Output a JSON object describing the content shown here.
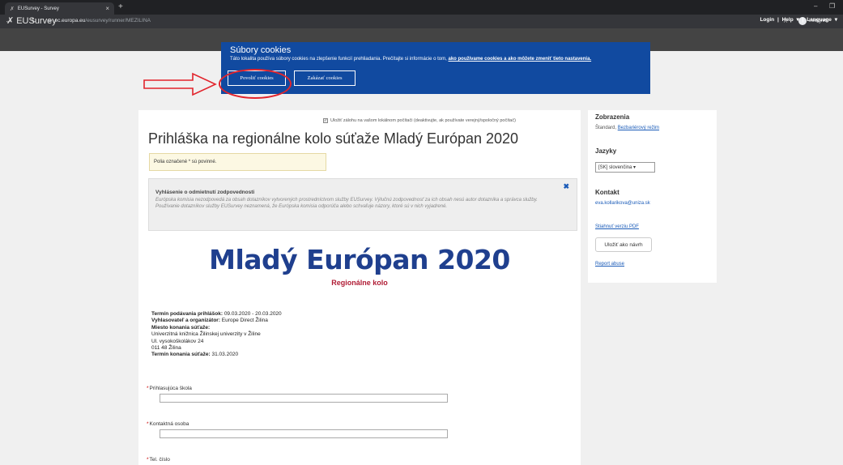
{
  "browser": {
    "tab_title": "EUSurvey - Survey",
    "url_host": "ec.europa.eu",
    "url_path": "/eusurvey/runner/MEZILINA",
    "incognito_label": "Inkognito"
  },
  "site": {
    "logo": "EUSurvey",
    "menu": [
      "Login",
      "|",
      "Help",
      "|",
      "Language"
    ]
  },
  "cookie": {
    "title": "Súbory cookies",
    "text": "Táto lokalita používa súbory cookies na zlepšenie funkcií prehliadania. Prečítajte si informácie o tom, ",
    "link": "ako používame cookies a ako môžete zmeniť tieto nastavenia.",
    "accept": "Povoliť cookies",
    "reject": "Zakázať cookies"
  },
  "form": {
    "backup_label": "Uložiť zálohu na vašom lokálnom počítači (deaktivujte, ak používate verejný/spoločný počítač)",
    "title": "Prihláška na regionálne kolo súťaže Mladý Európan 2020",
    "required_note": "Polia označené * sú povinné.",
    "disclaimer_title": "Vyhlásenie o odmietnutí zodpovednosti",
    "disclaimer_text": "Európska komisia nezodpovedá za obsah dotazníkov vytvorených prostredníctvom služby EUSurvey. Výlučnú zodpovednosť za ich obsah nesú autor dotazníka a správca služby. Používanie dotazníkov služby EUSurvey neznamená, že Európska komisia odporúča alebo schvaľuje názory, ktoré sú v nich vyjadrené.",
    "hero_title": "Mladý Európan 2020",
    "hero_sub": "Regionálne kolo",
    "info": {
      "deadline_label": "Termín podávania prihlášok:",
      "deadline": " 09.03.2020 - 20.03.2020",
      "organizer_label": "Vyhlasovateľ a organizátor:",
      "organizer": " Europe Direct Žilina",
      "venue_label": "Miesto konania súťaže:",
      "venue_1": "Univerzitná knižnica Žilinskej univerzity v Žiline",
      "venue_2": "Ul. vysokoškolákov 24",
      "venue_3": "011 48 Žilina",
      "date_label": "Termín konania súťaže:",
      "date": " 31.03.2020"
    },
    "fields": [
      "Prihlasujúca škola",
      "Kontaktná osoba",
      "Tel. číslo"
    ]
  },
  "sidebar": {
    "view_heading": "Zobrazenia",
    "view_standard": "Štandard",
    "view_accessible": "Bezbariérový režim",
    "lang_heading": "Jazyky",
    "lang_value": "[SK] slovenčina",
    "contact_heading": "Kontakt",
    "contact_email": "eva.kollarikova@uniza.sk",
    "pdf_link": "Stiahnuť verziu PDF",
    "save_draft": "Uložiť ako návrh",
    "report": "Report abuse"
  }
}
